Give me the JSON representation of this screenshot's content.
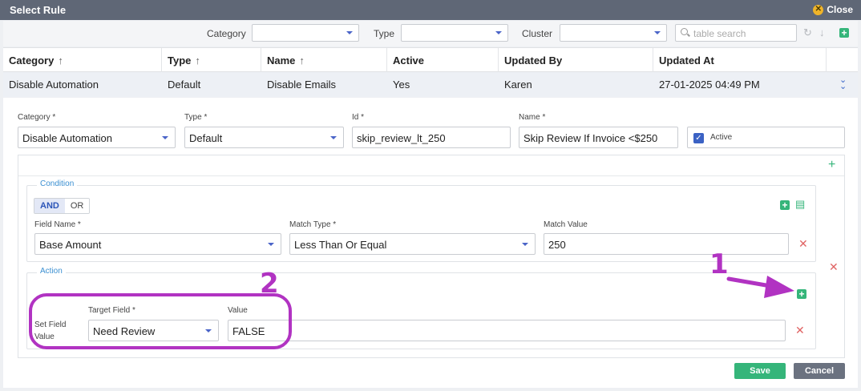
{
  "dialog": {
    "title": "Select Rule",
    "close_label": "Close"
  },
  "filters": {
    "category_label": "Category",
    "type_label": "Type",
    "cluster_label": "Cluster",
    "search_placeholder": "table search"
  },
  "table": {
    "columns": [
      "Category",
      "Type",
      "Name",
      "Active",
      "Updated By",
      "Updated At"
    ],
    "rows": [
      {
        "category": "Disable Automation",
        "type": "Default",
        "name": "Disable Emails",
        "active": "Yes",
        "updated_by": "Karen",
        "updated_at": "27-01-2025 04:49 PM"
      }
    ]
  },
  "form": {
    "category_label": "Category *",
    "category_value": "Disable Automation",
    "type_label": "Type *",
    "type_value": "Default",
    "id_label": "Id *",
    "id_value": "skip_review_lt_250",
    "name_label": "Name *",
    "name_value": "Skip Review If Invoice <$250",
    "active_label": "Active"
  },
  "condition": {
    "legend": "Condition",
    "and_label": "AND",
    "or_label": "OR",
    "field_name_label": "Field Name *",
    "field_name_value": "Base Amount",
    "match_type_label": "Match Type *",
    "match_type_value": "Less Than Or Equal",
    "match_value_label": "Match Value",
    "match_value": "250"
  },
  "action": {
    "legend": "Action",
    "set_field_label_1": "Set Field",
    "set_field_label_2": "Value",
    "target_field_label": "Target Field *",
    "target_field_value": "Need Review",
    "value_label": "Value",
    "value": "FALSE"
  },
  "buttons": {
    "save": "Save",
    "cancel": "Cancel"
  },
  "annotations": {
    "one": "1",
    "two": "2",
    "color": "#b133c2"
  },
  "colors": {
    "accent_green": "#35b57a",
    "titlebar": "#5f6776",
    "link_blue": "#3a8fd1",
    "delete_red": "#e06464"
  }
}
